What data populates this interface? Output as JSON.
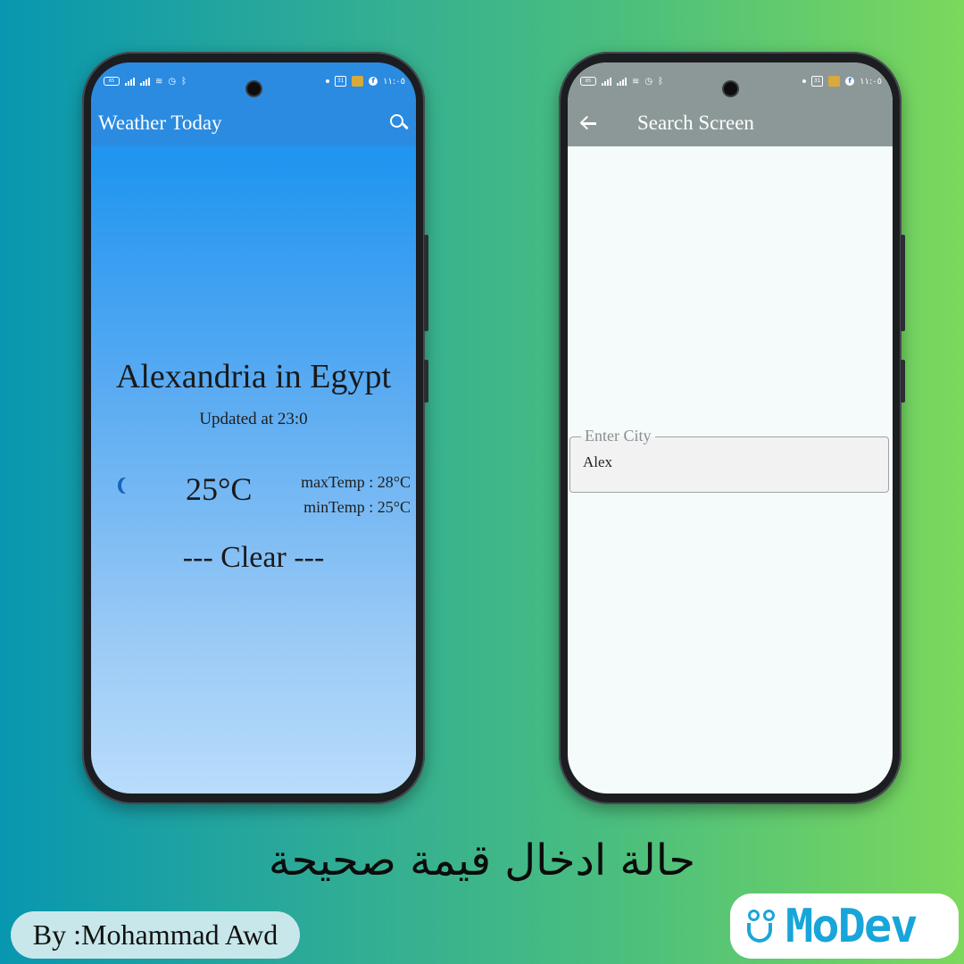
{
  "status_bar": {
    "battery": "65",
    "time": "١١:٠٥",
    "calendar_badge": "31",
    "fb": "f"
  },
  "weather_screen": {
    "title": "Weather Today",
    "city": "Alexandria in Egypt",
    "updated": "Updated at 23:0",
    "temp": "25°C",
    "max_temp": "maxTemp : 28°C",
    "min_temp": "minTemp : 25°C",
    "condition": "--- Clear ---",
    "icons": [
      "search-icon",
      "moon-icon"
    ],
    "colors": {
      "appbar": "#2b8be0",
      "gradient_top": "#2196f0",
      "gradient_bottom": "#b9dcfb"
    }
  },
  "search_screen": {
    "title": "Search Screen",
    "field_label": "Enter City",
    "field_value": "Alex",
    "icons": [
      "back-arrow-icon"
    ],
    "colors": {
      "appbar": "#8c9898",
      "background": "#f5fafa"
    }
  },
  "caption": "حالة ادخال قيمة صحيحة",
  "author": "By :Mohammad Awd",
  "brand": "MoDev",
  "colors": {
    "brand": "#18a5d9",
    "bg_left": "#0897b0",
    "bg_right": "#7bd85c"
  }
}
